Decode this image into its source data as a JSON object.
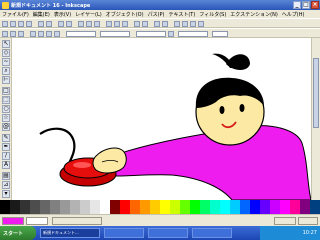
{
  "window": {
    "title": "新規ドキュメント 16 - Inkscape"
  },
  "menubar": {
    "items": [
      "ファイル(F)",
      "編集(E)",
      "表示(V)",
      "レイヤー(L)",
      "オブジェクト(O)",
      "パス(P)",
      "テキスト(T)",
      "フィルタ(S)",
      "エクステンション(N)",
      "ヘルプ(H)"
    ]
  },
  "colors": {
    "skin": "#fce9a4",
    "hair": "#000000",
    "sleeve": "#ee1cee",
    "button_red": "#e60d0d",
    "button_highlight": "#ff5555",
    "mouth": "#d61a1a",
    "title_bar": "#2a56b8"
  },
  "palette": [
    "#000000",
    "#1a1a1a",
    "#333333",
    "#4d4d4d",
    "#666666",
    "#808080",
    "#999999",
    "#b3b3b3",
    "#cccccc",
    "#e6e6e6",
    "#ffffff",
    "#800000",
    "#ff0000",
    "#ff6600",
    "#ff9900",
    "#ffcc00",
    "#ffff00",
    "#ccff00",
    "#66ff00",
    "#00ff00",
    "#00ff66",
    "#00ffcc",
    "#00ffff",
    "#00ccff",
    "#0066ff",
    "#0000ff",
    "#6600ff",
    "#cc00ff",
    "#ff00ff",
    "#ff0099",
    "#800080",
    "#004080"
  ],
  "taskbar": {
    "start_label": "スタート",
    "tasks": [
      "新規ドキュメント..."
    ],
    "time": "10:27"
  },
  "icons": [
    "app-icon",
    "minimize-icon",
    "maximize-icon",
    "close-icon",
    "select-tool-icon",
    "node-tool-icon",
    "zoom-tool-icon",
    "rect-tool-icon",
    "ellipse-tool-icon",
    "star-tool-icon",
    "spiral-tool-icon",
    "pencil-tool-icon",
    "pen-tool-icon",
    "calligraphy-tool-icon",
    "text-tool-icon",
    "gradient-tool-icon",
    "dropper-tool-icon"
  ]
}
